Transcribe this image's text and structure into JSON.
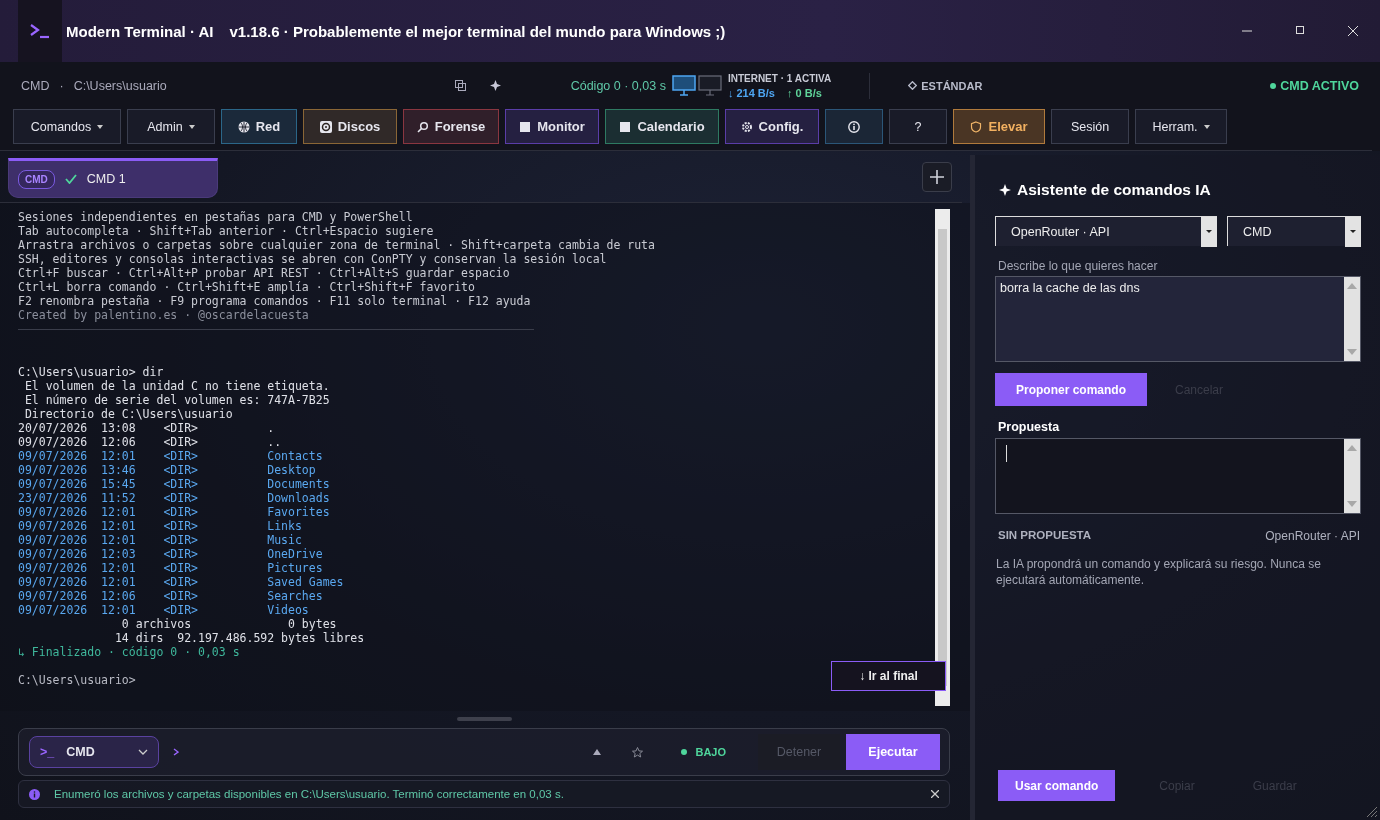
{
  "window": {
    "title": "Modern Terminal · AI",
    "subtitle": "v1.18.6 · Probablemente el mejor terminal del mundo para Windows ;)"
  },
  "header": {
    "shell": "CMD",
    "separator": "·",
    "path": "C:\\Users\\usuario",
    "exit_info": "Código 0 · 0,03 s",
    "network": {
      "label": "INTERNET · 1 ACTIVA",
      "download": "↓ 214 B/s",
      "upload": "↑ 0 B/s"
    },
    "mode": "ESTÁNDAR",
    "session_state": "CMD ACTIVO"
  },
  "toolbar": [
    {
      "label": "Comandos",
      "kind": "menu",
      "color": "#3a3e4e"
    },
    {
      "label": "Admin",
      "kind": "menu",
      "color": "#3a3e4e"
    },
    {
      "label": "Red",
      "kind": "plain",
      "color": "#2b6688"
    },
    {
      "label": "Discos",
      "kind": "plain",
      "color": "#8a6636"
    },
    {
      "label": "Forense",
      "kind": "plain",
      "color": "#8a3640"
    },
    {
      "label": "Monitor",
      "kind": "plain",
      "color": "#5a3da8"
    },
    {
      "label": "Calendario",
      "kind": "plain",
      "color": "#2e7a62"
    },
    {
      "label": "Config.",
      "kind": "plain",
      "color": "#5a3da8"
    },
    {
      "kind": "plain",
      "color": "#2b5678"
    },
    {
      "label": "?",
      "kind": "plain",
      "color": "#3a3e4e"
    },
    {
      "label": "Elevar",
      "kind": "plain",
      "color": "#b07a3c"
    },
    {
      "label": "Sesión",
      "kind": "plain",
      "color": "#3a3e4e"
    },
    {
      "label": "Herram.",
      "kind": "menu",
      "color": "#3a3e4e"
    }
  ],
  "tabs": [
    {
      "badge": "CMD",
      "label": "CMD 1",
      "selected": true,
      "completed": true
    }
  ],
  "terminal": {
    "lines": [
      {
        "kind": "info",
        "text": "Sesiones independientes en pestañas para CMD y PowerShell"
      },
      {
        "kind": "info",
        "text": "Tab autocompleta · Shift+Tab anterior · Ctrl+Espacio sugiere"
      },
      {
        "kind": "info",
        "text": "Arrastra archivos o carpetas sobre cualquier zona de terminal · Shift+carpeta cambia de ruta"
      },
      {
        "kind": "info",
        "text": "SSH, editores y consolas interactivas se abren con ConPTY y conservan la sesión local"
      },
      {
        "kind": "info",
        "text": "Ctrl+F buscar · Ctrl+Alt+P probar API REST · Ctrl+Alt+S guardar espacio"
      },
      {
        "kind": "info",
        "text": "Ctrl+L borra comando · Ctrl+Shift+E amplía · Ctrl+Shift+F favorito"
      },
      {
        "kind": "info",
        "text": "F2 renombra pestaña · F9 programa comandos · F11 solo terminal · F12 ayuda"
      },
      {
        "kind": "muted",
        "text": "Created by palentino.es · @oscardelacuesta"
      },
      {
        "kind": "rule"
      },
      {
        "kind": "prompt",
        "text": "C:\\Users\\usuario> dir"
      },
      {
        "kind": "text",
        "text": " El volumen de la unidad C no tiene etiqueta."
      },
      {
        "kind": "text",
        "text": " El número de serie del volumen es: 747A-7B25"
      },
      {
        "kind": "text",
        "text": " Directorio de C:\\Users\\usuario"
      },
      {
        "kind": "text",
        "text": "20/07/2026  13:08    <DIR>          ."
      },
      {
        "kind": "text",
        "text": "09/07/2026  12:06    <DIR>          .."
      },
      {
        "kind": "folder",
        "text": "09/07/2026  12:01    <DIR>          Contacts"
      },
      {
        "kind": "folder",
        "text": "09/07/2026  13:46    <DIR>          Desktop"
      },
      {
        "kind": "folder",
        "text": "09/07/2026  15:45    <DIR>          Documents"
      },
      {
        "kind": "folder",
        "text": "23/07/2026  11:52    <DIR>          Downloads"
      },
      {
        "kind": "folder",
        "text": "09/07/2026  12:01    <DIR>          Favorites"
      },
      {
        "kind": "folder",
        "text": "09/07/2026  12:01    <DIR>          Links"
      },
      {
        "kind": "folder",
        "text": "09/07/2026  12:01    <DIR>          Music"
      },
      {
        "kind": "folder",
        "text": "09/07/2026  12:03    <DIR>          OneDrive"
      },
      {
        "kind": "folder",
        "text": "09/07/2026  12:01    <DIR>          Pictures"
      },
      {
        "kind": "folder",
        "text": "09/07/2026  12:01    <DIR>          Saved Games"
      },
      {
        "kind": "folder",
        "text": "09/07/2026  12:06    <DIR>          Searches"
      },
      {
        "kind": "folder",
        "text": "09/07/2026  12:01    <DIR>          Videos"
      },
      {
        "kind": "text",
        "text": "               0 archivos              0 bytes"
      },
      {
        "kind": "text",
        "text": "              14 dirs  92.197.486.592 bytes libres"
      },
      {
        "kind": "done",
        "text": "↳ Finalizado · código 0 · 0,03 s"
      },
      {
        "kind": "prompt_cut",
        "text": "C:\\Users\\usuario>"
      }
    ],
    "jump_button": "↓ Ir al final"
  },
  "input_bar": {
    "shell_badge": ">_",
    "shell": "CMD",
    "risk": "BAJO",
    "buttons": [
      {
        "label": "Detener",
        "disabled": true
      },
      {
        "label": "Ejecutar",
        "disabled": false
      }
    ],
    "message": "Enumeró los archivos y carpetas disponibles en C:\\Users\\usuario. Terminó correctamente en 0,03 s."
  },
  "assistant": {
    "title": "Asistente de comandos IA",
    "provider": "OpenRouter · API",
    "shell": "CMD",
    "prompt_label": "Describe lo que quieres hacer",
    "prompt_value": "borra la cache de las dns",
    "actions": [
      {
        "label": "Proponer comando",
        "disabled": false
      },
      {
        "label": "Cancelar",
        "disabled": true
      }
    ],
    "proposal_label": "Propuesta",
    "status": "SIN PROPUESTA",
    "provider_note": "OpenRouter · API",
    "hint": "La IA propondrá un comando y explicará su riesgo. Nunca se ejecutará automáticamente.",
    "footer_actions": [
      {
        "label": "Usar comando",
        "disabled": false
      },
      {
        "label": "Copiar",
        "disabled": true
      },
      {
        "label": "Guardar",
        "disabled": true
      }
    ]
  }
}
